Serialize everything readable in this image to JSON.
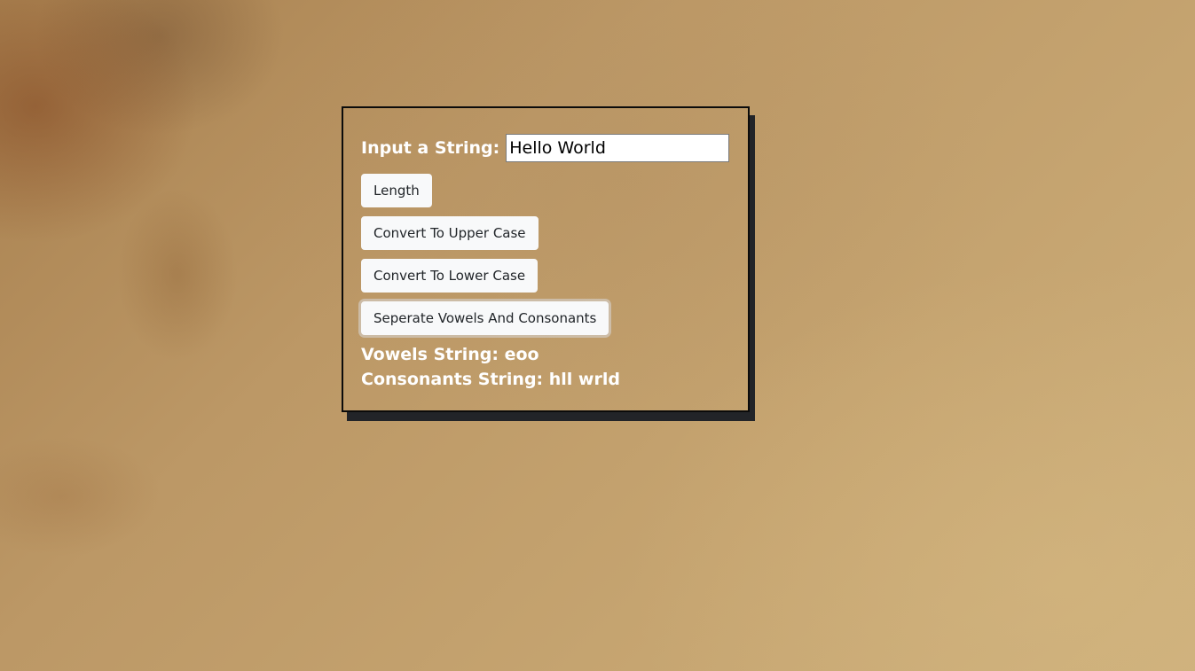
{
  "form": {
    "input_label": "Input a String:",
    "input_value": "Hello World"
  },
  "buttons": {
    "length": "Length",
    "upper": "Convert To Upper Case",
    "lower": "Convert To Lower Case",
    "separate": "Seperate Vowels And Consonants"
  },
  "results": {
    "vowels": "Vowels String: eoo",
    "consonants": "Consonants String: hll wrld"
  }
}
